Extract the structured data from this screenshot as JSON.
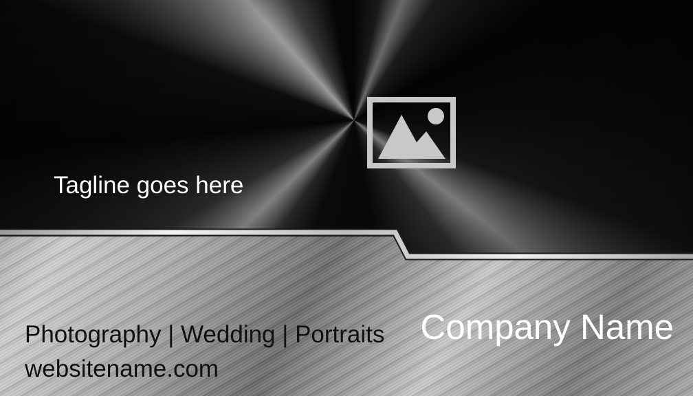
{
  "card": {
    "tagline": "Tagline goes here",
    "services": "Photography | Wedding | Portraits",
    "website": "websitename.com",
    "company_name": "Company Name",
    "image_placeholder_icon": "image-placeholder-icon"
  },
  "colors": {
    "top_panel": "#050505",
    "bottom_panel": "#b0b0b0",
    "placeholder": "#c8c8c8",
    "tagline_text": "#ffffff",
    "company_text": "#ffffff",
    "body_text": "#111111"
  }
}
